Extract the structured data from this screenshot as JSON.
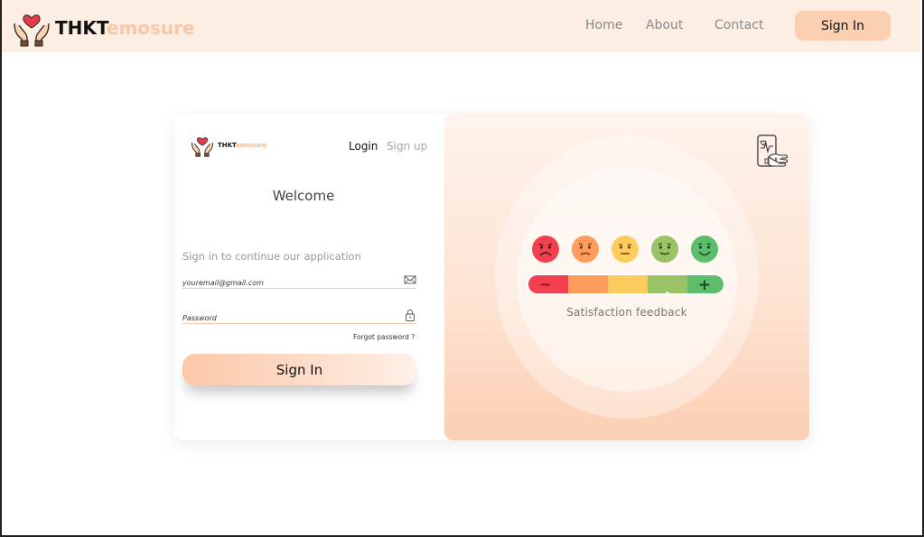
{
  "brand": {
    "name_dark": "THKT",
    "name_light": "emosure"
  },
  "nav": {
    "links": [
      "Home",
      "About",
      "Contact"
    ],
    "signin_label": "Sign In"
  },
  "login": {
    "tab_login": "Login",
    "tab_signup": "Sign up",
    "welcome": "Welcome",
    "subtitle": "Sign in to continue our application",
    "email_placeholder": "youremail@gmail.com",
    "password_placeholder": "Password",
    "forgot": "Forgot password ?",
    "signin_label": "Sign In"
  },
  "feedback": {
    "label": "Satisfaction feedback",
    "scale_minus": "−",
    "scale_plus": "+",
    "scale_colors": [
      "#f2404e",
      "#fd9c5b",
      "#fccd5e",
      "#9ac266",
      "#5cbe6a"
    ],
    "faces": [
      "very-unhappy-face-icon",
      "unhappy-face-icon",
      "neutral-face-icon",
      "happy-face-icon",
      "very-happy-face-icon"
    ]
  },
  "colors": {
    "accent": "#fbcfb2",
    "nav_bg": "#fdeee4",
    "brand_light": "#f8c8a6"
  }
}
